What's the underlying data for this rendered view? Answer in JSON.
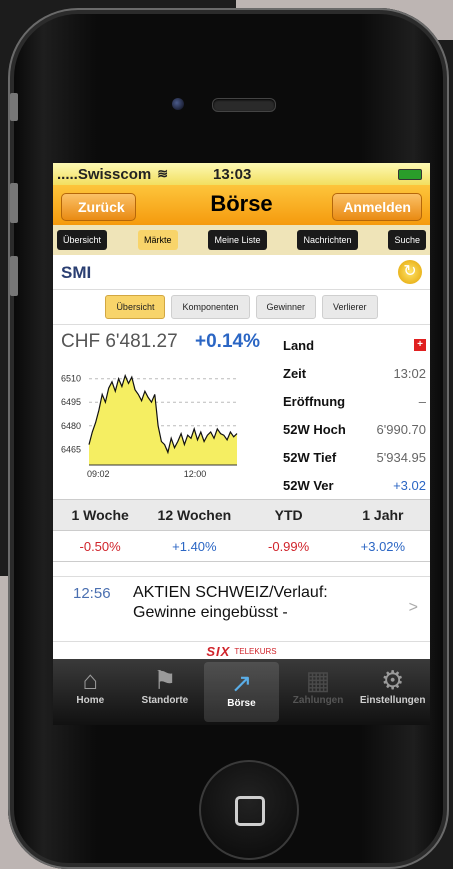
{
  "status_bar": {
    "carrier": ".....Swisscom",
    "wifi": "≋",
    "time": "13:03"
  },
  "nav": {
    "back": "Zurück",
    "title": "Börse",
    "login": "Anmelden"
  },
  "tabs": [
    {
      "label": "Übersicht",
      "active": false
    },
    {
      "label": "Märkte",
      "active": true
    },
    {
      "label": "Meine Liste",
      "active": false
    },
    {
      "label": "Nachrichten",
      "active": false
    },
    {
      "label": "Suche",
      "active": false
    }
  ],
  "index": {
    "name": "SMI"
  },
  "segments": [
    {
      "label": "Übersicht",
      "active": true
    },
    {
      "label": "Komponenten",
      "active": false
    },
    {
      "label": "Gewinner",
      "active": false
    },
    {
      "label": "Verlierer",
      "active": false
    }
  ],
  "quote": {
    "price": "CHF 6'481.27",
    "change": "+0.14%"
  },
  "info": {
    "land_label": "Land",
    "land_flag": "+",
    "zeit_label": "Zeit",
    "zeit_value": "13:02",
    "open_label": "Eröffnung",
    "open_value": "–",
    "high_label": "52W Hoch",
    "high_value": "6'990.70",
    "low_label": "52W Tief",
    "low_value": "5'934.95",
    "ver_label": "52W Ver",
    "ver_value": "+3.02"
  },
  "chart_data": {
    "type": "area",
    "y_ticks": [
      "6510",
      "6495",
      "6480",
      "6465"
    ],
    "x_ticks": [
      "09:02",
      "12:00"
    ],
    "ylim": [
      6455,
      6520
    ],
    "values": [
      6468,
      6476,
      6482,
      6490,
      6500,
      6495,
      6504,
      6508,
      6502,
      6510,
      6505,
      6512,
      6507,
      6511,
      6503,
      6500,
      6496,
      6502,
      6498,
      6495,
      6500,
      6480,
      6470,
      6468,
      6463,
      6472,
      6466,
      6470,
      6475,
      6468,
      6474,
      6472,
      6478,
      6471,
      6476,
      6470,
      6474,
      6476,
      6472,
      6478,
      6475,
      6474,
      6471,
      6476,
      6473,
      6475
    ]
  },
  "performance": {
    "headers": [
      "1 Woche",
      "12 Wochen",
      "YTD",
      "1 Jahr"
    ],
    "values": [
      "-0.50%",
      "+1.40%",
      "-0.99%",
      "+3.02%"
    ]
  },
  "news": {
    "time": "12:56",
    "headline": "AKTIEN SCHWEIZ/Verlauf: Gewinne eingebüsst -"
  },
  "brand": {
    "logo": "SIX",
    "text": "TELEKURS"
  },
  "tabbar": [
    {
      "label": "Home",
      "icon": "⌂",
      "state": "normal"
    },
    {
      "label": "Standorte",
      "icon": "⚑",
      "state": "normal"
    },
    {
      "label": "Börse",
      "icon": "↗",
      "state": "active"
    },
    {
      "label": "Zahlungen",
      "icon": "▦",
      "state": "disabled"
    },
    {
      "label": "Einstellungen",
      "icon": "⚙",
      "state": "normal"
    }
  ]
}
